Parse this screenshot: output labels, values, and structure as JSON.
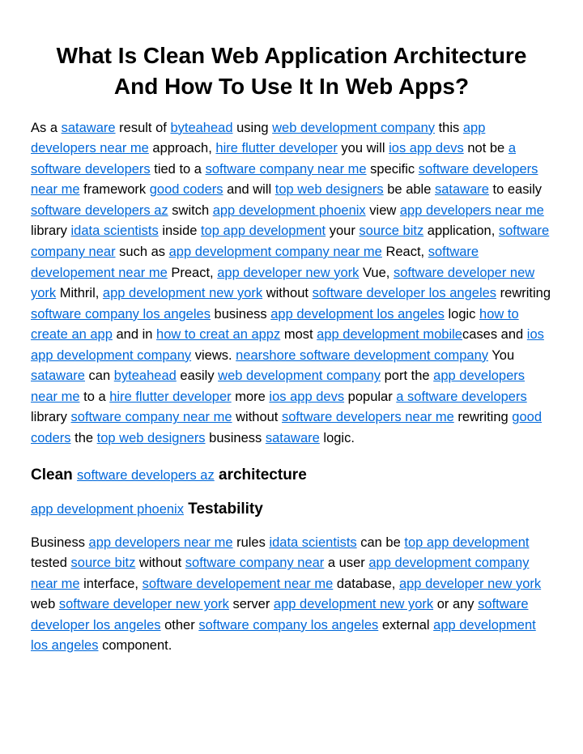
{
  "title": "What Is Clean Web Application Architecture And How To Use It In Web Apps?",
  "p1": {
    "t0": "As a ",
    "l0": "sataware",
    "t1": " result of ",
    "l1": "byteahead",
    "t2": " using ",
    "l2": "web development company",
    "t3": " this ",
    "l3": "app developers near me",
    "t4": " approach, ",
    "l4": "hire flutter developer",
    "t5": " you will ",
    "l5": "ios app devs",
    "t6": " not be ",
    "l6": "a software developers",
    "t7": " tied to a ",
    "l7": "software company near me",
    "t8": " specific ",
    "l8": "software developers near me",
    "t9": " framework ",
    "l9": "good coders",
    "t10": " and will ",
    "l10": "top web designers",
    "t11": " be able ",
    "l11": "sataware",
    "t12": " to easily ",
    "l12": "software developers az",
    "t13": " switch ",
    "l13": "app development phoenix",
    "t14": " view ",
    "l14": "app developers near me",
    "t15": " library ",
    "l15": "idata scientists",
    "t16": " inside ",
    "l16": "top app development",
    "t17": " your ",
    "l17": "source bitz",
    "t18": " application, ",
    "l18": "software company near",
    "t19": " such as ",
    "l19": "app development company near me",
    "t20": " React, ",
    "l20": "software developement near me",
    "t21": " Preact, ",
    "l21": "app developer new york",
    "t22": " Vue, ",
    "l22": "software developer new york",
    "t23": " Mithril, ",
    "l23": "app development new york",
    "t24": " without ",
    "l24": "software developer los angeles",
    "t25": " rewriting ",
    "l25": "software company los angeles",
    "t26": " business ",
    "l26": "app development los angeles",
    "t27": " logic ",
    "l27": "how to create an app",
    "t28": " and in ",
    "l28": "how to creat an appz",
    "t29": " most ",
    "l29": "app development mobile",
    "t30": "cases and ",
    "l30": "ios app development company",
    "t31": " views. ",
    "l31": "nearshore software development company",
    "t32": " You ",
    "l32": "sataware",
    "t33": " can ",
    "l33": "byteahead",
    "t34": " easily ",
    "l34": "web development company",
    "t35": " port the ",
    "l35": "app developers near me",
    "t36": " to a ",
    "l36": "hire flutter developer",
    "t37": " more ",
    "l37": "ios app devs",
    "t38": " popular ",
    "l38": "a software developers",
    "t39": " library ",
    "l39": "software company near me",
    "t40": " without ",
    "l40": "software developers near me",
    "t41": " rewriting ",
    "l41": "good coders",
    "t42": " the ",
    "l42": "top web designers",
    "t43": " business ",
    "l43": "sataware",
    "t44": " logic."
  },
  "h2": {
    "t0": "Clean ",
    "l0": "software developers az",
    "t1": " architecture"
  },
  "h3": {
    "l0": "app development phoenix",
    "t0": " Testability"
  },
  "p2": {
    "t0": "Business ",
    "l0": "app developers near me",
    "t1": " rules ",
    "l1": "idata scientists",
    "t2": " can be ",
    "l2": "top app development",
    "t3": " tested ",
    "l3": "source bitz",
    "t4": " without ",
    "l4": "software company near",
    "t5": " a user ",
    "l5": "app development company near me",
    "t6": " interface, ",
    "l6": "software developement near me",
    "t7": " database, ",
    "l7": "app developer new york",
    "t8": " web ",
    "l8": "software developer new york",
    "t9": " server ",
    "l9": "app development new york",
    "t10": " or any ",
    "l10": "software developer los angeles",
    "t11": " other ",
    "l11": "software company los angeles",
    "t12": " external ",
    "l12": "app development los angeles",
    "t13": " component."
  }
}
